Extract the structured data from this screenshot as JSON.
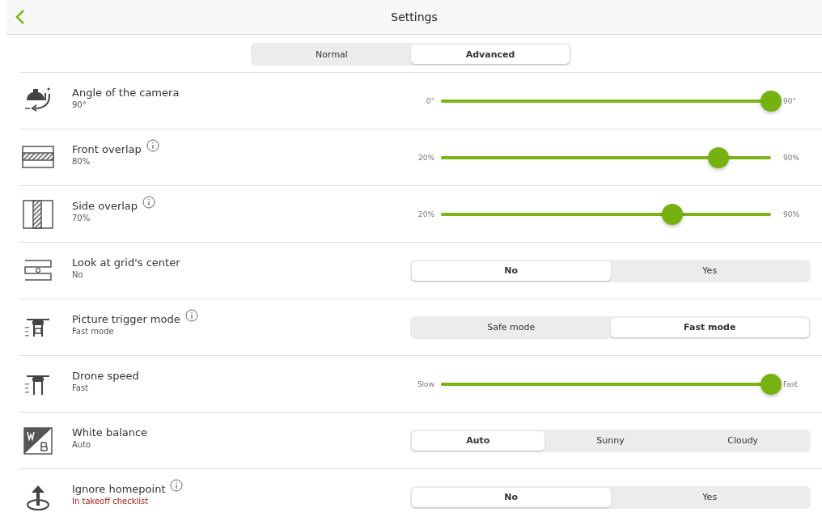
{
  "header": {
    "title": "Settings"
  },
  "tabs": [
    {
      "label": "Normal",
      "selected": false
    },
    {
      "label": "Advanced",
      "selected": true
    }
  ],
  "settings": [
    {
      "title": "Angle of the camera",
      "subtitle": "90°",
      "alert": false,
      "info": false,
      "control": {
        "kind": "slider",
        "min_label": "0°",
        "max_label": "90°",
        "level": 1
      }
    },
    {
      "title": "Front overlap",
      "subtitle": "80%",
      "alert": false,
      "info": true,
      "control": {
        "kind": "slider",
        "min_label": "20%",
        "max_label": "90%",
        "level": 0.84
      }
    },
    {
      "title": "Side overlap",
      "subtitle": "70%",
      "alert": false,
      "info": true,
      "control": {
        "kind": "slider",
        "min_label": "20%",
        "max_label": "90%",
        "level": 0.7
      }
    },
    {
      "title": "Look at grid's center",
      "subtitle": "No",
      "alert": false,
      "info": false,
      "control": {
        "kind": "segmented",
        "options": [
          {
            "label": "No",
            "selected": true
          },
          {
            "label": "Yes",
            "selected": false
          }
        ]
      }
    },
    {
      "title": "Picture trigger mode",
      "subtitle": "Fast mode",
      "alert": false,
      "info": true,
      "control": {
        "kind": "segmented",
        "options": [
          {
            "label": "Safe mode",
            "selected": false
          },
          {
            "label": "Fast mode",
            "selected": true
          }
        ]
      }
    },
    {
      "title": "Drone speed",
      "subtitle": "Fast",
      "alert": false,
      "info": false,
      "control": {
        "kind": "slider",
        "min_label": "Slow",
        "max_label": "Fast",
        "level": 1
      }
    },
    {
      "title": "White balance",
      "subtitle": "Auto",
      "alert": false,
      "info": false,
      "control": {
        "kind": "segmented",
        "options": [
          {
            "label": "Auto",
            "selected": true
          },
          {
            "label": "Sunny",
            "selected": false
          },
          {
            "label": "Cloudy",
            "selected": false
          }
        ]
      }
    },
    {
      "title": "Ignore homepoint",
      "subtitle": "In takeoff checklist",
      "alert": true,
      "info": true,
      "control": {
        "kind": "segmented",
        "options": [
          {
            "label": "No",
            "selected": true
          },
          {
            "label": "Yes",
            "selected": false
          }
        ]
      }
    }
  ]
}
